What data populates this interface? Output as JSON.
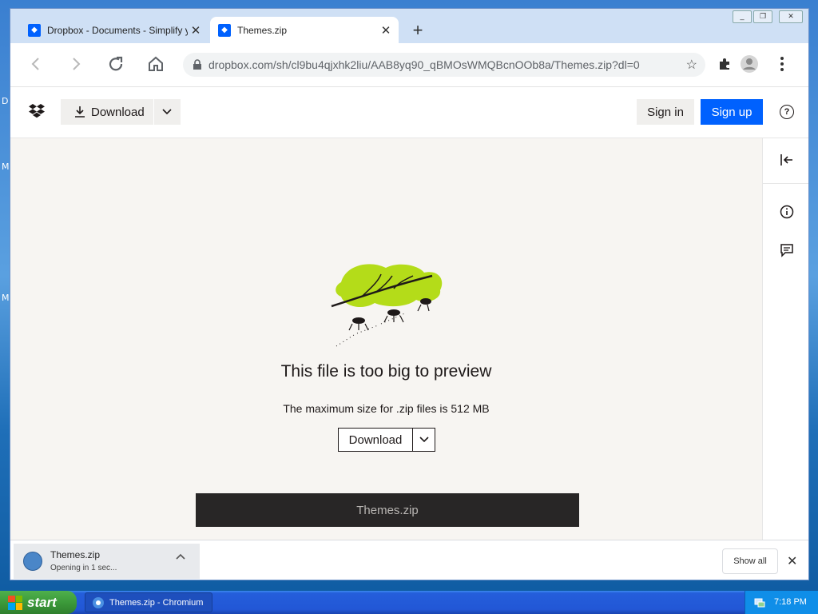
{
  "desktop": {
    "side_letters": [
      "D",
      "M",
      "M"
    ]
  },
  "browser": {
    "tabs": [
      {
        "title": "Dropbox - Documents - Simplify your",
        "active": false
      },
      {
        "title": "Themes.zip",
        "active": true
      }
    ],
    "new_tab_glyph": "+",
    "window_controls": [
      "minimize",
      "restore",
      "close"
    ],
    "url": "dropbox.com/sh/cl9bu4qjxhk2liu/AAB8yq90_qBMOsWMQBcnOOb8a/Themes.zip?dl=0"
  },
  "dropbox_header": {
    "download_label": "Download",
    "signin_label": "Sign in",
    "signup_label": "Sign up",
    "help_glyph": "?"
  },
  "preview": {
    "title": "This file is too big to preview",
    "subtitle": "The maximum size for .zip files is 512 MB",
    "download_label": "Download",
    "filename": "Themes.zip"
  },
  "download_shelf": {
    "file_name": "Themes.zip",
    "status": "Opening in 1 sec...",
    "show_all_label": "Show all"
  },
  "taskbar": {
    "start_label": "start",
    "task_label": "Themes.zip - Chromium",
    "clock": "7:18 PM"
  },
  "colors": {
    "dropbox_blue": "#0061fe",
    "content_bg": "#f7f5f2",
    "leaf_green": "#b4dc19",
    "filebar_bg": "#282626"
  }
}
